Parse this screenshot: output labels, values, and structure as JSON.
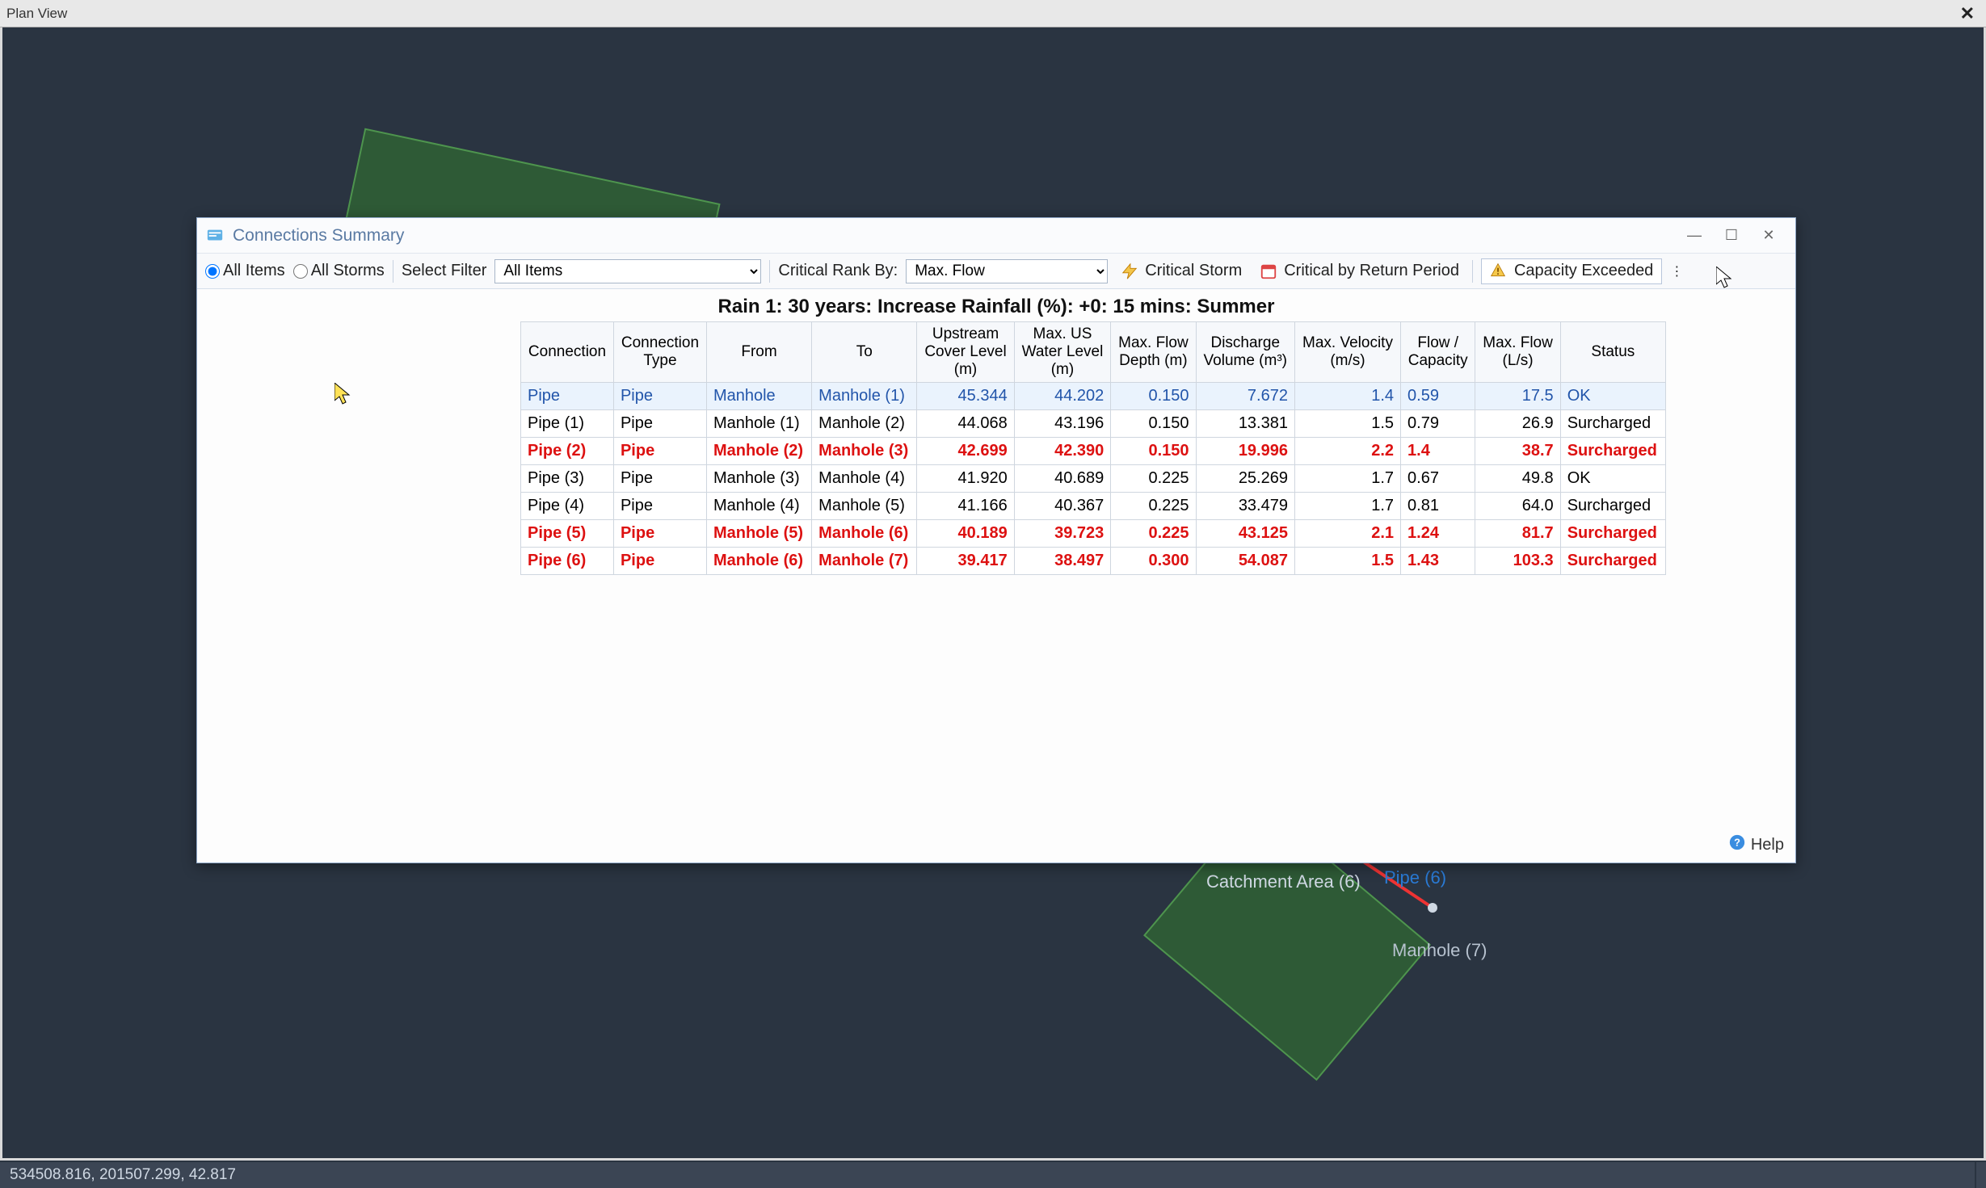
{
  "outer": {
    "title": "Plan View"
  },
  "dialog": {
    "title": "Connections Summary"
  },
  "toolbar": {
    "all_items_radio": "All Items",
    "all_storms_radio": "All Storms",
    "select_filter_label": "Select Filter",
    "select_filter_value": "All Items",
    "critical_rank_label": "Critical Rank By:",
    "critical_rank_value": "Max. Flow",
    "critical_storm": "Critical Storm",
    "critical_by_return": "Critical by Return Period",
    "capacity_exceeded": "Capacity Exceeded"
  },
  "caption": "Rain 1: 30 years: Increase Rainfall (%): +0: 15 mins: Summer",
  "columns": {
    "connection": "Connection",
    "type": "Connection\nType",
    "from": "From",
    "to": "To",
    "ucl": "Upstream\nCover Level\n(m)",
    "uwl": "Max. US\nWater Level\n(m)",
    "depth": "Max. Flow\nDepth (m)",
    "dvol": "Discharge\nVolume (m³)",
    "vel": "Max. Velocity\n(m/s)",
    "fcap": "Flow /\nCapacity",
    "mflow": "Max. Flow\n(L/s)",
    "status": "Status"
  },
  "rows": [
    {
      "sel": true,
      "red": false,
      "c": "Pipe",
      "t": "Pipe",
      "f": "Manhole",
      "to": "Manhole (1)",
      "ucl": "45.344",
      "uwl": "44.202",
      "d": "0.150",
      "dv": "7.672",
      "v": "1.4",
      "fc": "0.59",
      "mf": "17.5",
      "st": "OK"
    },
    {
      "sel": false,
      "red": false,
      "c": "Pipe (1)",
      "t": "Pipe",
      "f": "Manhole (1)",
      "to": "Manhole (2)",
      "ucl": "44.068",
      "uwl": "43.196",
      "d": "0.150",
      "dv": "13.381",
      "v": "1.5",
      "fc": "0.79",
      "mf": "26.9",
      "st": "Surcharged"
    },
    {
      "sel": false,
      "red": true,
      "c": "Pipe (2)",
      "t": "Pipe",
      "f": "Manhole (2)",
      "to": "Manhole (3)",
      "ucl": "42.699",
      "uwl": "42.390",
      "d": "0.150",
      "dv": "19.996",
      "v": "2.2",
      "fc": "1.4",
      "mf": "38.7",
      "st": "Surcharged"
    },
    {
      "sel": false,
      "red": false,
      "c": "Pipe (3)",
      "t": "Pipe",
      "f": "Manhole (3)",
      "to": "Manhole (4)",
      "ucl": "41.920",
      "uwl": "40.689",
      "d": "0.225",
      "dv": "25.269",
      "v": "1.7",
      "fc": "0.67",
      "mf": "49.8",
      "st": "OK"
    },
    {
      "sel": false,
      "red": false,
      "c": "Pipe (4)",
      "t": "Pipe",
      "f": "Manhole (4)",
      "to": "Manhole (5)",
      "ucl": "41.166",
      "uwl": "40.367",
      "d": "0.225",
      "dv": "33.479",
      "v": "1.7",
      "fc": "0.81",
      "mf": "64.0",
      "st": "Surcharged"
    },
    {
      "sel": false,
      "red": true,
      "c": "Pipe (5)",
      "t": "Pipe",
      "f": "Manhole (5)",
      "to": "Manhole (6)",
      "ucl": "40.189",
      "uwl": "39.723",
      "d": "0.225",
      "dv": "43.125",
      "v": "2.1",
      "fc": "1.24",
      "mf": "81.7",
      "st": "Surcharged"
    },
    {
      "sel": false,
      "red": true,
      "c": "Pipe (6)",
      "t": "Pipe",
      "f": "Manhole (6)",
      "to": "Manhole (7)",
      "ucl": "39.417",
      "uwl": "38.497",
      "d": "0.300",
      "dv": "54.087",
      "v": "1.5",
      "fc": "1.43",
      "mf": "103.3",
      "st": "Surcharged"
    }
  ],
  "help_label": "Help",
  "map": {
    "catchment6": "Catchment Area (6)",
    "pipe6": "Pipe (6)",
    "manhole7": "Manhole (7)"
  },
  "statusbar": {
    "coords": "534508.816, 201507.299, 42.817"
  }
}
